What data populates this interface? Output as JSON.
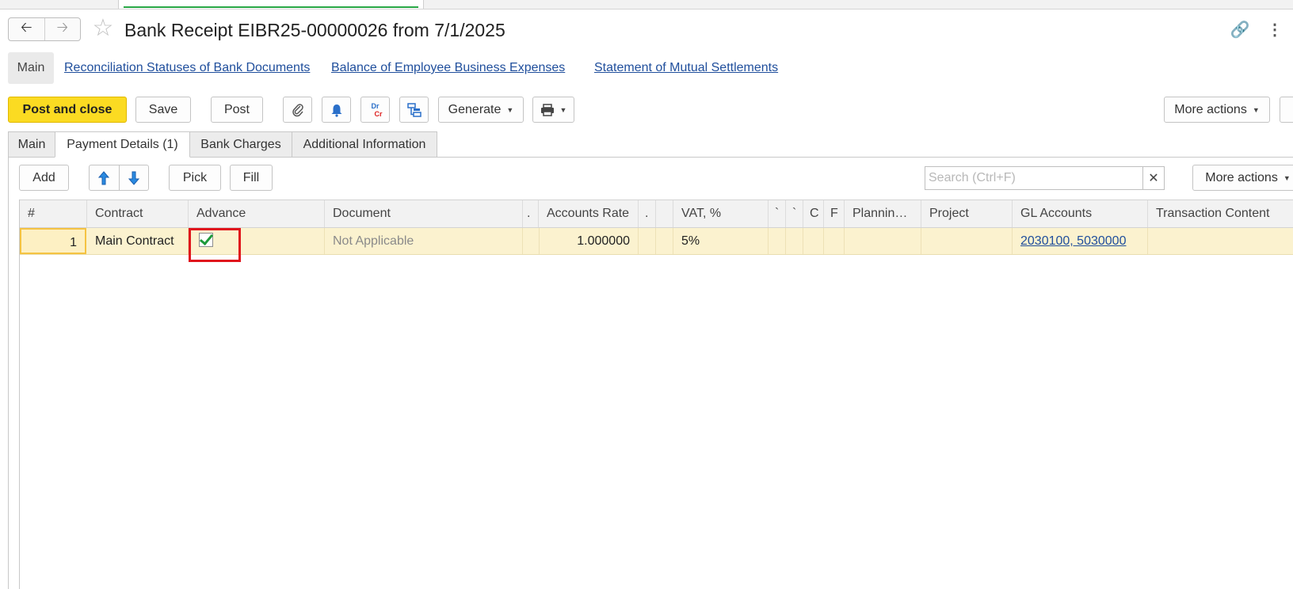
{
  "window": {
    "title": "Bank Receipt EIBR25-00000026 from 7/1/2025"
  },
  "nav": {
    "back_icon": "back-arrow-icon",
    "forward_icon": "forward-arrow-icon",
    "favorite_icon": "star-icon",
    "link_icon": "link-icon",
    "more_icon": "kebab-menu-icon"
  },
  "top_links": {
    "main": "Main",
    "items": [
      "Reconciliation Statuses of Bank Documents",
      "Balance of Employee Business Expenses",
      "Statement of Mutual Settlements"
    ]
  },
  "toolbar": {
    "post_and_close": "Post and close",
    "save": "Save",
    "post": "Post",
    "attach_icon": "paperclip-icon",
    "reminder_icon": "bell-icon",
    "drcr_top": "Dr",
    "drcr_bottom": "Cr",
    "structure_icon": "document-structure-icon",
    "generate": "Generate",
    "print_icon": "printer-icon",
    "more_actions": "More actions"
  },
  "tabs": [
    "Main",
    "Payment Details (1)",
    "Bank Charges",
    "Additional Information"
  ],
  "active_tab": "Payment Details (1)",
  "table_toolbar": {
    "add": "Add",
    "move_up_icon": "arrow-up-icon",
    "move_down_icon": "arrow-down-icon",
    "pick": "Pick",
    "fill": "Fill",
    "search_placeholder": "Search (Ctrl+F)",
    "clear_icon": "clear-x-icon",
    "more_actions": "More actions"
  },
  "table": {
    "columns": [
      "#",
      "Contract",
      "Advance",
      "Document",
      ".",
      "Accounts Rate",
      ".",
      "",
      "VAT, %",
      "`",
      "`",
      "C",
      "F",
      "Plannin…",
      "Project",
      "GL Accounts",
      "Transaction Content"
    ],
    "rows": [
      {
        "number": "1",
        "contract": "Main Contract",
        "advance": true,
        "document": "Not Applicable",
        "accounts_rate": "1.000000",
        "vat": "5%",
        "gl_accounts": "2030100, 5030000"
      }
    ]
  },
  "colors": {
    "primary_button": "#fbdb22",
    "row_highlight": "#fbf2cf",
    "link": "#1f4e9c",
    "annotation_box": "#e0141c",
    "check": "#1e9a3a"
  }
}
